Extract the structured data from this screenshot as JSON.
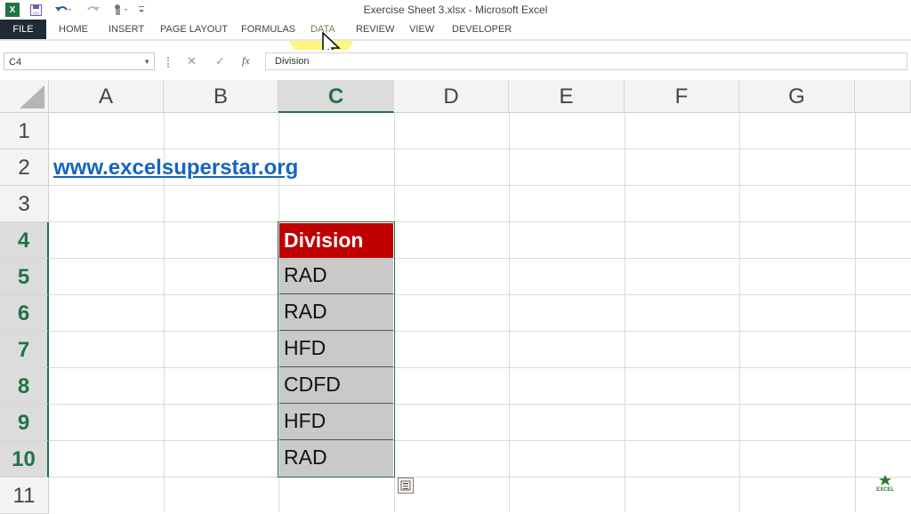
{
  "window": {
    "title": "Exercise Sheet 3.xlsx - Microsoft Excel"
  },
  "ribbon": {
    "tabs": [
      "FILE",
      "HOME",
      "INSERT",
      "PAGE LAYOUT",
      "FORMULAS",
      "DATA",
      "REVIEW",
      "VIEW",
      "DEVELOPER"
    ]
  },
  "formula_bar": {
    "name_box": "C4",
    "cancel": "✕",
    "enter": "✓",
    "fx": "fx",
    "value": "Division"
  },
  "sheet": {
    "columns": [
      "A",
      "B",
      "C",
      "D",
      "E",
      "F",
      "G"
    ],
    "selected_column": "C",
    "rows": [
      "1",
      "2",
      "3",
      "4",
      "5",
      "6",
      "7",
      "8",
      "9",
      "10",
      "11"
    ],
    "selected_rows": [
      "4",
      "5",
      "6",
      "7",
      "8",
      "9",
      "10"
    ],
    "link": "www.excelsuperstar.org",
    "header_cell": "Division",
    "values": [
      "RAD",
      "RAD",
      "HFD",
      "CDFD",
      "HFD",
      "RAD"
    ]
  },
  "watermark": {
    "logo_text": "EXCEL"
  },
  "colors": {
    "accent": "#217346",
    "header_fill": "#c00000",
    "cell_fill": "#c9c9c9",
    "link": "#1565c0",
    "spotlight": "#fff564"
  }
}
